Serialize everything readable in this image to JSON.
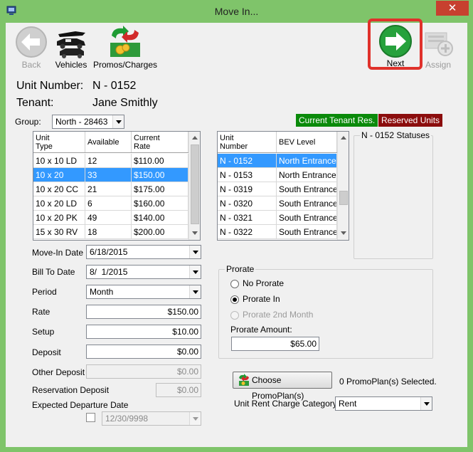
{
  "window": {
    "title": "Move In...",
    "close_glyph": "✕"
  },
  "toolbar": {
    "back_label": "Back",
    "vehicles_label": "Vehicles",
    "promos_label": "Promos/Charges",
    "next_label": "Next",
    "assign_label": "Assign"
  },
  "header": {
    "unit_number_label": "Unit Number:",
    "unit_number": "N - 0152",
    "tenant_label": "Tenant:",
    "tenant_name": "Jane Smithly"
  },
  "group": {
    "label": "Group:",
    "value": "North - 28463"
  },
  "badges": {
    "current_tenant_res": "Current Tenant Res.",
    "reserved_units": "Reserved Units"
  },
  "unit_types": {
    "headers": [
      "Unit\nType",
      "Available",
      "Current\nRate"
    ],
    "rows": [
      {
        "type": "10 x 10 LD",
        "available": "12",
        "rate": "$110.00"
      },
      {
        "type": "10 x 20",
        "available": "33",
        "rate": "$150.00",
        "selected": true
      },
      {
        "type": "10 x 20 CC",
        "available": "21",
        "rate": "$175.00"
      },
      {
        "type": "10 x 20 LD",
        "available": "6",
        "rate": "$160.00"
      },
      {
        "type": "10 x 20 PK",
        "available": "49",
        "rate": "$140.00"
      },
      {
        "type": "15 x 30 RV",
        "available": "18",
        "rate": "$200.00"
      }
    ]
  },
  "units": {
    "headers": [
      "Unit\nNumber",
      "BEV Level"
    ],
    "rows": [
      {
        "unit": "N - 0152",
        "level": "North Entrance",
        "selected": true
      },
      {
        "unit": "N - 0153",
        "level": "North Entrance"
      },
      {
        "unit": "N - 0319",
        "level": "South Entrance"
      },
      {
        "unit": "N - 0320",
        "level": "South Entrance"
      },
      {
        "unit": "N - 0321",
        "level": "South Entrance"
      },
      {
        "unit": "N - 0322",
        "level": "South Entrance"
      }
    ]
  },
  "statuses": {
    "title": "N - 0152 Statuses"
  },
  "form": {
    "move_in_date_label": "Move-In Date",
    "move_in_date": "6/18/2015",
    "bill_to_date_label": "Bill To Date",
    "bill_to_date": "8/  1/2015",
    "period_label": "Period",
    "period": "Month",
    "rate_label": "Rate",
    "rate": "$150.00",
    "setup_label": "Setup",
    "setup": "$10.00",
    "deposit_label": "Deposit",
    "deposit": "$0.00",
    "other_deposit_label": "Other Deposit",
    "other_deposit": "$0.00",
    "reservation_deposit_label": "Reservation Deposit",
    "reservation_deposit": "$0.00",
    "expected_departure_label": "Expected Departure Date",
    "expected_departure": "12/30/9998"
  },
  "prorate": {
    "title": "Prorate",
    "no_prorate": "No Prorate",
    "prorate_in": "Prorate In",
    "prorate_2nd": "Prorate 2nd Month",
    "amount_label": "Prorate Amount:",
    "amount": "$65.00"
  },
  "promo": {
    "button_label": "Choose PromoPlan(s)",
    "selected_text": "0 PromoPlan(s) Selected."
  },
  "rent_category": {
    "label": "Unit Rent Charge Category",
    "value": "Rent"
  },
  "colors": {
    "title_bar": "#7fc46a",
    "highlight": "#e0312b",
    "selection": "#3399ff",
    "badge_green": "#0a8a0a",
    "badge_red": "#8b0d0d"
  }
}
